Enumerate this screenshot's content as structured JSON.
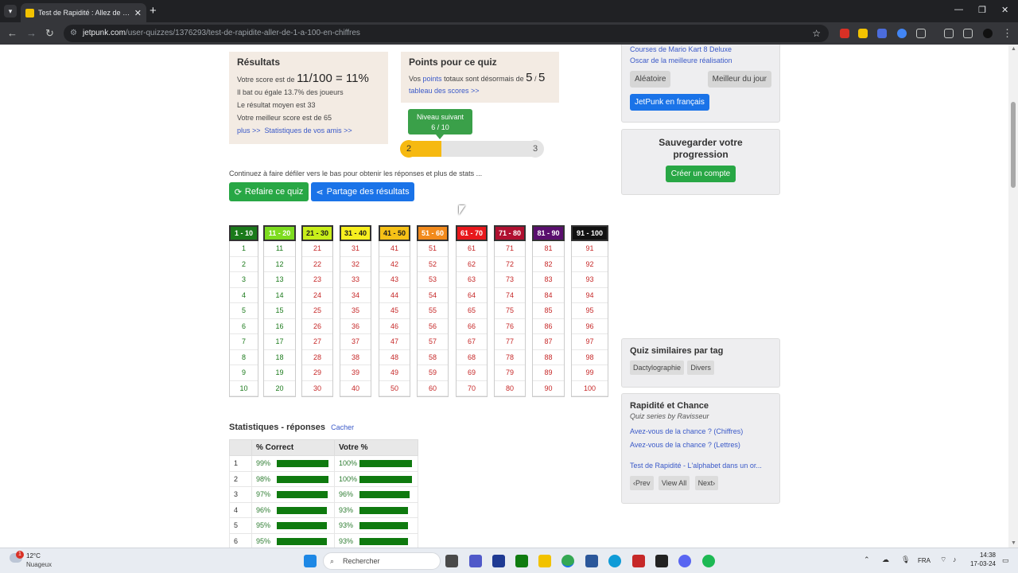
{
  "browser": {
    "tab_title": "Test de Rapidité : Allez de 1 à 100",
    "url_host": "jetpunk.com",
    "url_path": "/user-quizzes/1376293/test-de-rapidite-aller-de-1-a-100-en-chiffres"
  },
  "results": {
    "title": "Résultats",
    "score_prefix": "Votre score est de",
    "score_big": "11/100 = 11%",
    "beats": "Il bat ou égale 13.7% des joueurs",
    "average": "Le résultat moyen est 33",
    "best": "Votre meilleur score est de 65",
    "more_link": "plus >>",
    "friends_link": "Statistiques de vos amis >>"
  },
  "points": {
    "title": "Points pour ce quiz",
    "text_prefix": "Vos",
    "points_link": "points",
    "text_suffix": "totaux sont désormais de",
    "value": "5",
    "sep": "/",
    "max": "5",
    "scores_link": "tableau des scores >>"
  },
  "level": {
    "tooltip_title": "Niveau suivant",
    "tooltip_value": "6 / 10",
    "current": "2",
    "next": "3",
    "progress": 0.6
  },
  "continue_text": "Continuez à faire défiler vers le bas pour obtenir les réponses et plus de stats ...",
  "buttons": {
    "retry": "Refaire ce quiz",
    "share": "Partage des résultats"
  },
  "grid": [
    {
      "head": "1 - 10",
      "bg": "#1a7a1a",
      "fg": "#ffffff",
      "green": true,
      "cells": [
        "1",
        "2",
        "3",
        "4",
        "5",
        "6",
        "7",
        "8",
        "9",
        "10"
      ]
    },
    {
      "head": "11 - 20",
      "bg": "#7ddc1f",
      "fg": "#ffffff",
      "green": true,
      "cells": [
        "11",
        "12",
        "13",
        "14",
        "15",
        "16",
        "17",
        "18",
        "19",
        "20"
      ]
    },
    {
      "head": "21 - 30",
      "bg": "#c8ee1a",
      "fg": "#1a1a1a",
      "green": false,
      "cells": [
        "21",
        "22",
        "23",
        "24",
        "25",
        "26",
        "27",
        "28",
        "29",
        "30"
      ]
    },
    {
      "head": "31 - 40",
      "bg": "#f7ef1f",
      "fg": "#1a1a1a",
      "green": false,
      "cells": [
        "31",
        "32",
        "33",
        "34",
        "35",
        "36",
        "37",
        "38",
        "39",
        "40"
      ]
    },
    {
      "head": "41 - 50",
      "bg": "#f6c117",
      "fg": "#1a1a1a",
      "green": false,
      "cells": [
        "41",
        "42",
        "43",
        "44",
        "45",
        "46",
        "47",
        "48",
        "49",
        "50"
      ]
    },
    {
      "head": "51 - 60",
      "bg": "#f28a1c",
      "fg": "#ffffff",
      "green": false,
      "cells": [
        "51",
        "52",
        "53",
        "54",
        "55",
        "56",
        "57",
        "58",
        "59",
        "60"
      ]
    },
    {
      "head": "61 - 70",
      "bg": "#e8181c",
      "fg": "#ffffff",
      "green": false,
      "cells": [
        "61",
        "62",
        "63",
        "64",
        "65",
        "66",
        "67",
        "68",
        "69",
        "70"
      ]
    },
    {
      "head": "71 - 80",
      "bg": "#b01030",
      "fg": "#ffffff",
      "green": false,
      "cells": [
        "71",
        "72",
        "73",
        "74",
        "75",
        "76",
        "77",
        "78",
        "79",
        "80"
      ]
    },
    {
      "head": "81 - 90",
      "bg": "#5a0f6e",
      "fg": "#ffffff",
      "green": false,
      "cells": [
        "81",
        "82",
        "83",
        "84",
        "85",
        "86",
        "87",
        "88",
        "89",
        "90"
      ]
    },
    {
      "head": "91 - 100",
      "bg": "#111111",
      "fg": "#ffffff",
      "green": false,
      "cells": [
        "91",
        "92",
        "93",
        "94",
        "95",
        "96",
        "97",
        "98",
        "99",
        "100"
      ]
    }
  ],
  "stats": {
    "title": "Statistiques - réponses",
    "hide_link": "Cacher",
    "col_correct": "% Correct",
    "col_yours": "Votre %",
    "rows": [
      {
        "n": "1",
        "correct": "99%",
        "correct_val": 0.99,
        "yours": "100%",
        "yours_val": 1.0
      },
      {
        "n": "2",
        "correct": "98%",
        "correct_val": 0.98,
        "yours": "100%",
        "yours_val": 1.0
      },
      {
        "n": "3",
        "correct": "97%",
        "correct_val": 0.97,
        "yours": "96%",
        "yours_val": 0.96
      },
      {
        "n": "4",
        "correct": "96%",
        "correct_val": 0.96,
        "yours": "93%",
        "yours_val": 0.93
      },
      {
        "n": "5",
        "correct": "95%",
        "correct_val": 0.95,
        "yours": "93%",
        "yours_val": 0.93
      },
      {
        "n": "6",
        "correct": "95%",
        "correct_val": 0.95,
        "yours": "93%",
        "yours_val": 0.93
      }
    ]
  },
  "sidebar": {
    "link_top_partial": "Courses de Mario Kart 8 Deluxe",
    "oscar_link": "Oscar de la meilleure réalisation",
    "random_btn": "Aléatoire",
    "best_day_btn": "Meilleur du jour",
    "french_btn": "JetPunk en français",
    "save_title": "Sauvegarder votre progression",
    "create_account_btn": "Créer un compte",
    "similar_title": "Quiz similaires par tag",
    "tags": [
      "Dactylographie",
      "Divers"
    ],
    "series_title": "Rapidité et Chance",
    "series_by_label": "Quiz series by",
    "series_author": "Ravisseur",
    "series_links": [
      "Avez-vous de la chance ? (Chiffres)",
      "Avez-vous de la chance ? (Lettres)"
    ],
    "series_next_link": "Test de Rapidité - L'alphabet dans un or...",
    "prev_btn": "Prev",
    "view_all_btn": "View All",
    "next_btn": "Next"
  },
  "taskbar": {
    "weather_badge": "1",
    "weather_temp": "12°C",
    "weather_desc": "Nuageux",
    "search_placeholder": "Rechercher",
    "lang": "FRA",
    "time": "14:38",
    "date": "17-03-24"
  },
  "colors": {
    "primary_green": "#28a745",
    "primary_blue": "#1a73e8",
    "progress_orange": "#f6b911"
  }
}
